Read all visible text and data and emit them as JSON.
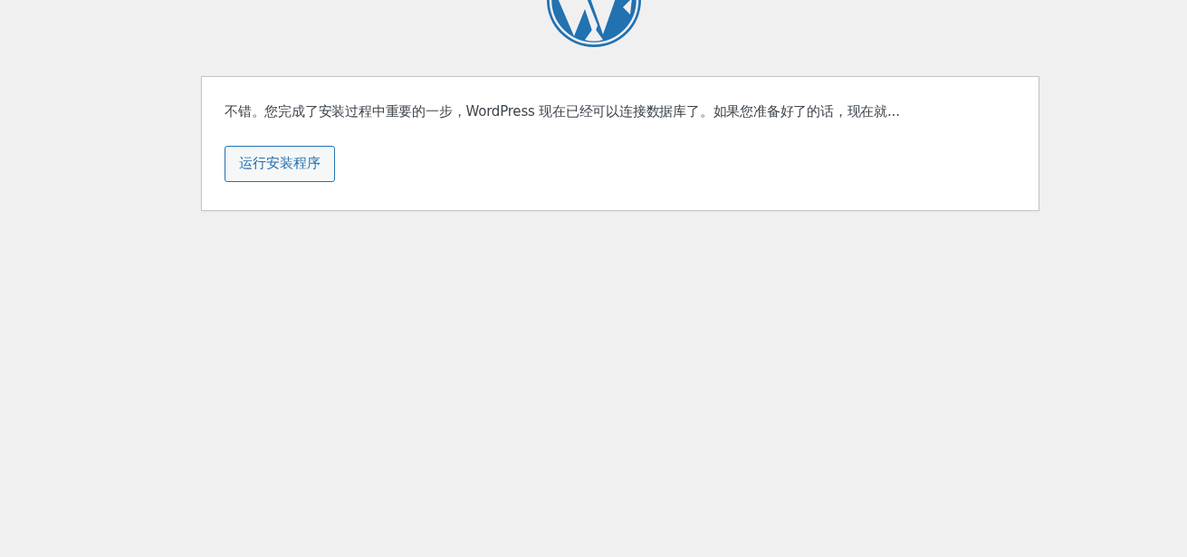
{
  "message": "不错。您完成了安装过程中重要的一步，WordPress 现在已经可以连接数据库了。如果您准备好了的话，现在就...",
  "button": {
    "label": "运行安装程序"
  }
}
